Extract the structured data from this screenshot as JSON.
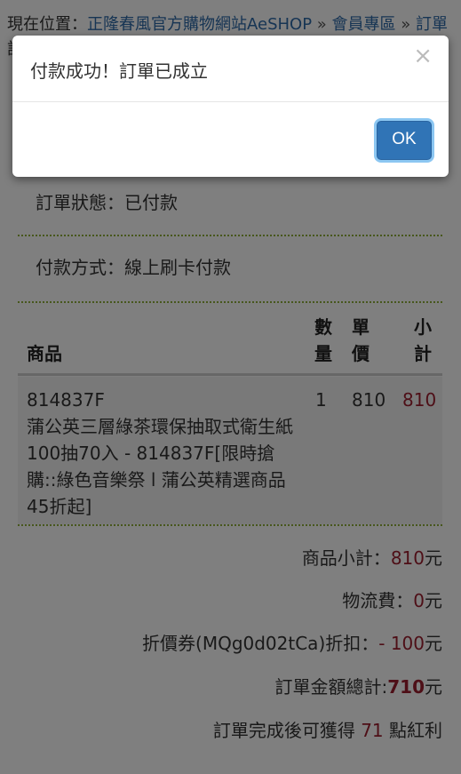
{
  "breadcrumb": {
    "prefix": "現在位置：",
    "crumbs": [
      "正隆春風官方購物網站AeSHOP",
      "會員專區",
      "訂單"
    ],
    "separator": "»",
    "overflow": "訂"
  },
  "order_status": "訂單狀態：已付款",
  "payment_method": "付款方式：線上刷卡付款",
  "table": {
    "headers": {
      "product": "商品",
      "qty": "數量",
      "price": "單價",
      "subtotal": "小計"
    },
    "rows": [
      {
        "code": "814837F",
        "name": "蒲公英三層綠茶環保抽取式衛生紙100抽70入 - 814837F[限時搶購::綠色音樂祭 l 蒲公英精選商品45折起]",
        "qty": "1",
        "price": "810",
        "subtotal": "810"
      }
    ]
  },
  "summary": {
    "product_subtotal_label": "商品小計：",
    "product_subtotal_value": "810",
    "shipping_label": "物流費：",
    "shipping_value": "0",
    "coupon_label": "折價券(MQg0d02tCa)折扣：",
    "coupon_value": "- 100",
    "total_label": "訂單金額總計:",
    "total_value": "710",
    "currency": "元",
    "points_prefix": "訂單完成後可獲得 ",
    "points_value": "71",
    "points_suffix": " 點紅利"
  },
  "modal": {
    "message": "付款成功！訂單已成立",
    "close_symbol": "×",
    "ok_label": "OK"
  },
  "colors": {
    "link": "#2e6aa8",
    "price_red": "#9c1e2e",
    "divider_green": "#8fae3a",
    "button_blue": "#3074b6"
  }
}
